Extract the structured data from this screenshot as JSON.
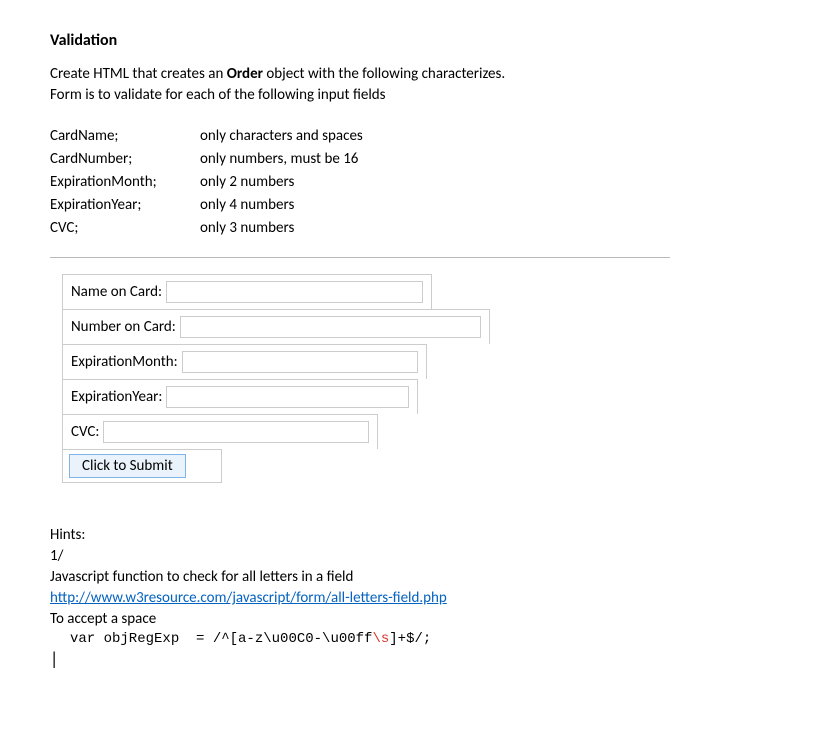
{
  "heading": "Validation",
  "intro_line1": "Create HTML that creates an ",
  "intro_bold": "Order",
  "intro_line1_rest": " object with the following characterizes.",
  "intro_line2": "Form is to validate for each of the following input fields",
  "fields": [
    {
      "name": "CardName;",
      "rule": "only characters and spaces"
    },
    {
      "name": "CardNumber;",
      "rule": "only numbers, must be 16"
    },
    {
      "name": "ExpirationMonth;",
      "rule": "only 2 numbers"
    },
    {
      "name": "ExpirationYear;",
      "rule": "only 4 numbers"
    },
    {
      "name": "CVC;",
      "rule": "only 3 numbers"
    }
  ],
  "form": {
    "labels": {
      "cardname": "Name on Card:",
      "cardnumber": "Number on Card:",
      "expmonth": "ExpirationMonth:",
      "expyear": "ExpirationYear:",
      "cvc": "CVC:"
    },
    "submit_label": "Click to Submit"
  },
  "hints": {
    "label": "Hints:",
    "num": "1/",
    "desc": "Javascript function to check for all letters in a field",
    "link_text": "http://www.w3resource.com/javascript/form/all-letters-field.php",
    "accept": "To accept a space"
  },
  "code": {
    "prefix": "var objRegExp  = ",
    "regex_pre": "/^[a-z\\u00C0-\\u00ff",
    "regex_red": "\\s",
    "regex_post": "]+$/",
    "suffix": ";"
  }
}
